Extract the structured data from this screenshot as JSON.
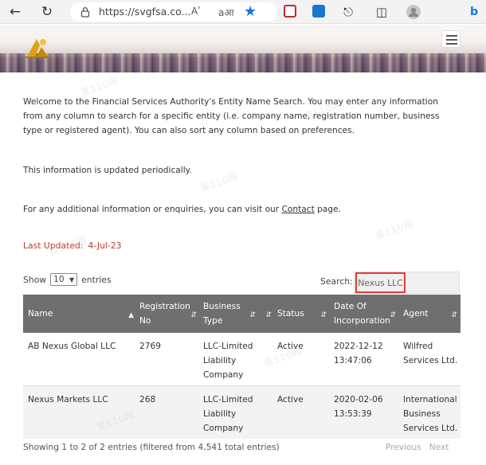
{
  "browser": {
    "url": "https://svgfsa.co...",
    "read_aloud": "Aʹ",
    "translate": "aआ"
  },
  "intro": {
    "p1": "Welcome to the Financial Services Authority's Entity Name Search. You may enter any information from any column to search for a specific entity (i.e. company name, registration number, business type or registered agent). You can also sort any column based on preferences.",
    "p2": "This information is updated periodically.",
    "p3_before": "For any additional information or enquiries, you can visit our ",
    "p3_link": "Contact",
    "p3_after": " page."
  },
  "last_updated": {
    "label": "Last Updated:",
    "value": "4-Jul-23"
  },
  "controls": {
    "show_label": "Show",
    "entries_value": "10",
    "entries_label": "entries",
    "search_label": "Search:",
    "search_value": "Nexus LLC"
  },
  "table": {
    "headers": [
      "Name",
      "Registration No",
      "Business Type",
      "Status",
      "Date Of Incorporation",
      "Agent"
    ],
    "rows": [
      [
        "AB Nexus Global LLC",
        "2769",
        "LLC-Limited Liability Company",
        "Active",
        "2022-12-12 13:47:06",
        "Wilfred Services Ltd."
      ],
      [
        "Nexus Markets LLC",
        "268",
        "LLC-Limited Liability Company",
        "Active",
        "2020-02-06 13:53:39",
        "International Business Services Ltd."
      ]
    ]
  },
  "footer": {
    "info": "Showing 1 to 2 of 2 entries (filtered from 4,541 total entries)",
    "previous": "Previous",
    "next": "Next"
  },
  "watermark": "享110网",
  "colors": {
    "header_bg": "#6f6f6f",
    "last_updated": "#c0392b",
    "search_highlight": "#e53935",
    "edge_blue": "#1a73e8"
  }
}
